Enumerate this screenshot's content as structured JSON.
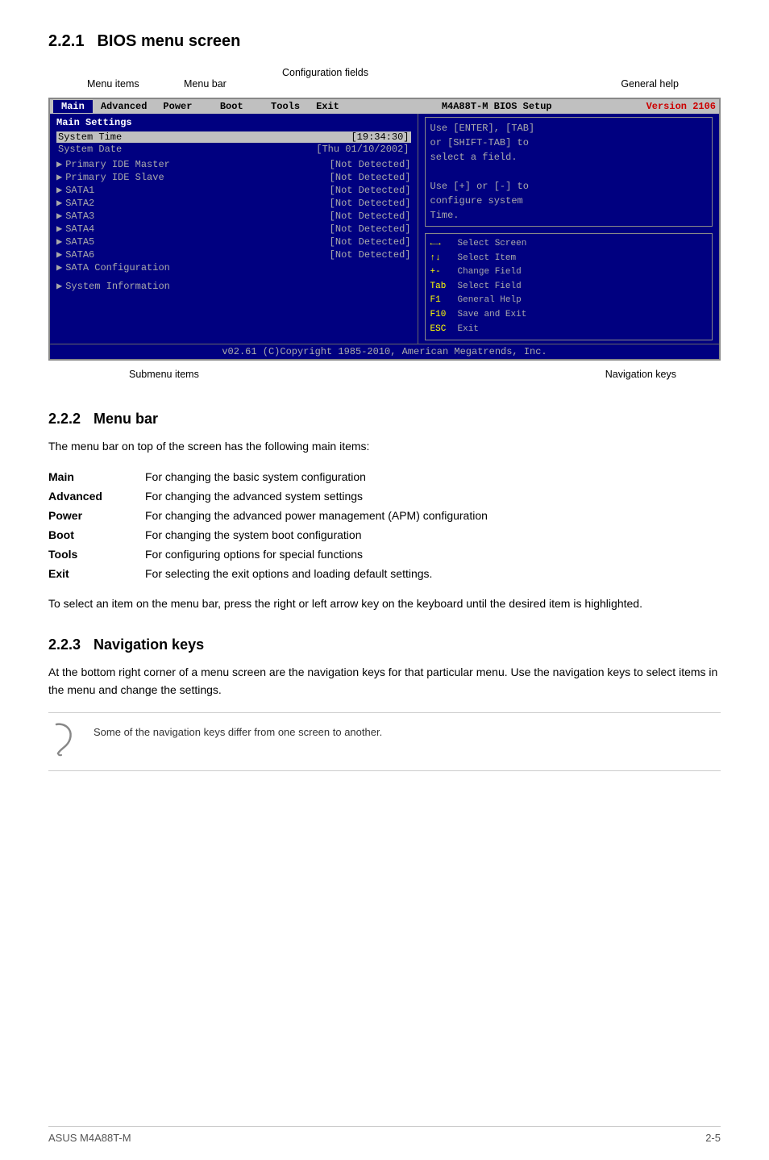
{
  "page": {
    "footer_left": "ASUS M4A88T-M",
    "footer_right": "2-5"
  },
  "section221": {
    "number": "2.2.1",
    "title": "BIOS menu screen",
    "labels": {
      "menu_items": "Menu items",
      "menu_bar": "Menu bar",
      "config_fields": "Configuration fields",
      "general_help": "General help",
      "submenu_items": "Submenu items",
      "navigation_keys": "Navigation keys"
    },
    "bios": {
      "menubar_title": "M4A88T-M BIOS Setup",
      "version": "Version 2106",
      "menu_items": [
        "Main",
        "Advanced",
        "Power",
        "Boot",
        "Tools",
        "Exit"
      ],
      "active_item": "Main",
      "section_title": "Main Settings",
      "system_time_label": "System Time",
      "system_time_value": "[19:34:30]",
      "system_date_label": "System Date",
      "system_date_value": "[Thu 01/10/2002]",
      "drives": [
        {
          "label": "Primary IDE Master",
          "value": "[Not Detected]"
        },
        {
          "label": "Primary IDE Slave",
          "value": "[Not Detected]"
        },
        {
          "label": "SATA1",
          "value": "[Not Detected]"
        },
        {
          "label": "SATA2",
          "value": "[Not Detected]"
        },
        {
          "label": "SATA3",
          "value": "[Not Detected]"
        },
        {
          "label": "SATA4",
          "value": "[Not Detected]"
        },
        {
          "label": "SATA5",
          "value": "[Not Detected]"
        },
        {
          "label": "SATA6",
          "value": "[Not Detected]"
        }
      ],
      "sata_config": "SATA Configuration",
      "system_info": "System Information",
      "help_text1": "Use [ENTER], [TAB]",
      "help_text2": "or [SHIFT-TAB] to",
      "help_text3": "select a field.",
      "help_text4": "Use [+] or [-] to",
      "help_text5": "configure system",
      "help_text6": "Time.",
      "nav": [
        {
          "key": "←→",
          "desc": "Select Screen"
        },
        {
          "key": "↑↓",
          "desc": "Select Item"
        },
        {
          "key": "+-",
          "desc": "Change Field"
        },
        {
          "key": "Tab",
          "desc": "Select Field"
        },
        {
          "key": "F1",
          "desc": "General Help"
        },
        {
          "key": "F10",
          "desc": "Save and Exit"
        },
        {
          "key": "ESC",
          "desc": "Exit"
        }
      ],
      "footer": "v02.61  (C)Copyright 1985-2010, American Megatrends, Inc."
    }
  },
  "section222": {
    "number": "2.2.2",
    "title": "Menu bar",
    "description": "The menu bar on top of the screen has the following main items:",
    "items": [
      {
        "label": "Main",
        "description": "For changing the basic system configuration"
      },
      {
        "label": "Advanced",
        "description": "For changing the advanced system settings"
      },
      {
        "label": "Power",
        "description": "For changing the advanced power management (APM) configuration"
      },
      {
        "label": "Boot",
        "description": "For changing the system boot configuration"
      },
      {
        "label": "Tools",
        "description": "For configuring options for special functions"
      },
      {
        "label": "Exit",
        "description": "For selecting the exit options and loading default settings."
      }
    ],
    "select_note": "To select an item on the menu bar, press the right or left arrow key on the keyboard until the desired item is highlighted."
  },
  "section223": {
    "number": "2.2.3",
    "title": "Navigation keys",
    "description": "At the bottom right corner of a menu screen are the navigation keys for that particular menu. Use the navigation keys to select items in the menu and change the settings.",
    "note": "Some of the navigation keys differ from one screen to another."
  }
}
